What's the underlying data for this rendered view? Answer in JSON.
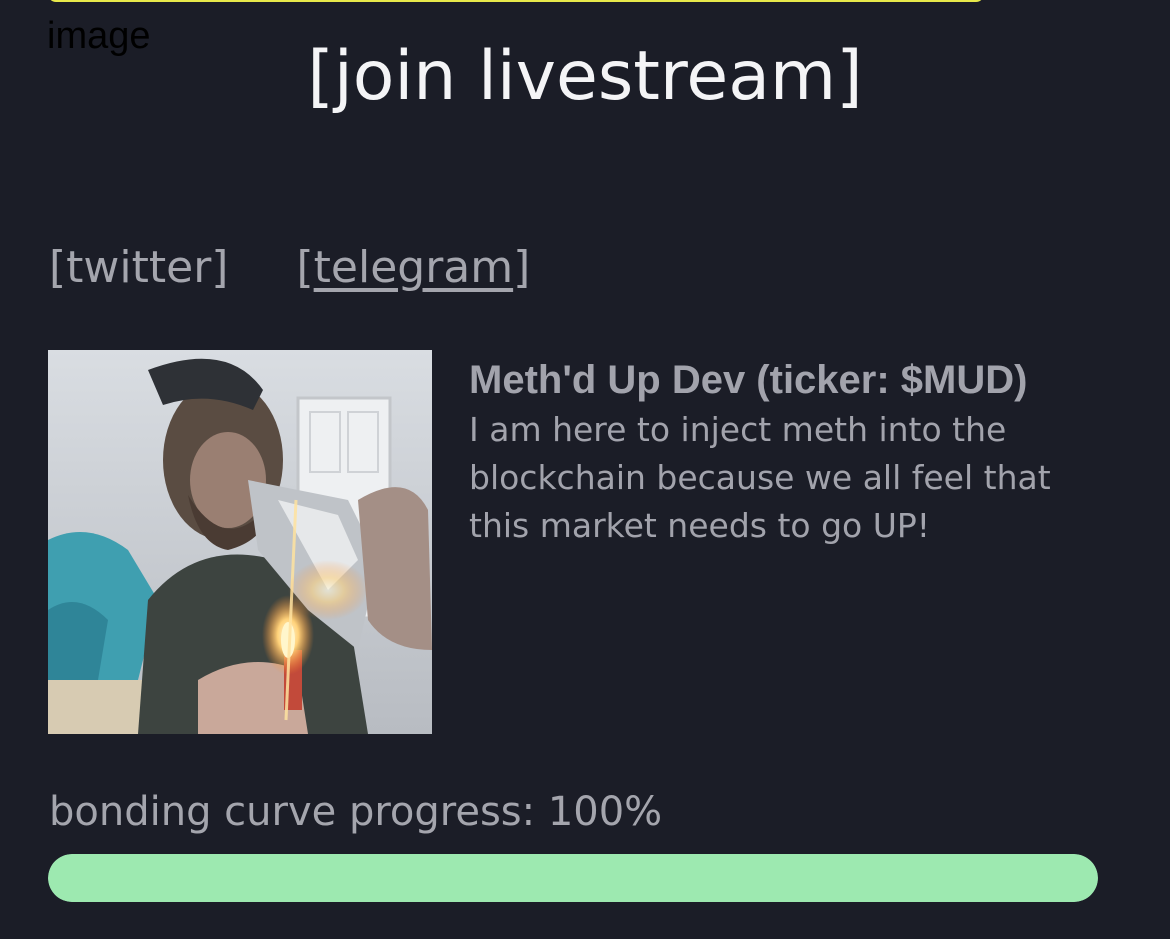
{
  "broken_image_alt": "image",
  "join": {
    "label": "[join livestream]"
  },
  "socials": {
    "twitter_label": "[twitter]",
    "telegram_open": "[",
    "telegram_text": "telegram",
    "telegram_close": "]"
  },
  "token": {
    "image_alt": "token image",
    "name": "Meth'd Up Dev (ticker: $MUD)",
    "description": "I am here to inject meth into the blockchain because we all feel that this market needs to go UP!"
  },
  "progress": {
    "label": "bonding curve progress: 100%",
    "fraction": 1.0,
    "color": "#9de9b0"
  },
  "colors": {
    "background": "#1b1d27",
    "top_border": "#e7e84a",
    "title": "#f4f4f6",
    "muted_text": "#a2a3ac"
  }
}
